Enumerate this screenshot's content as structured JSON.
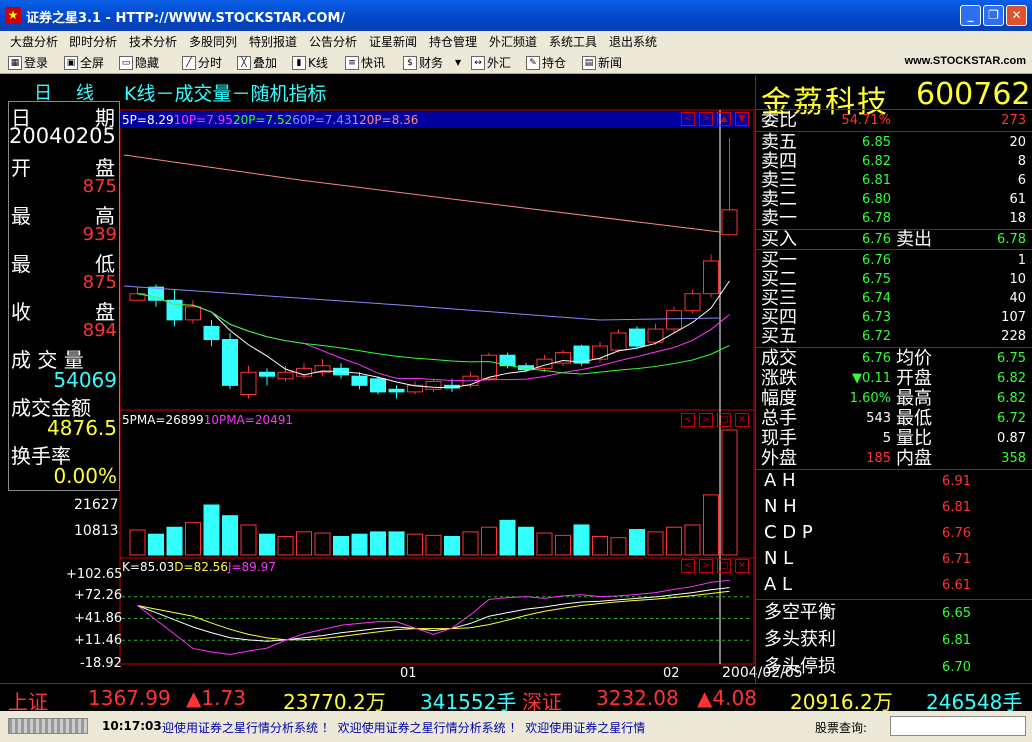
{
  "window": {
    "title": "证券之星3.1 - HTTP://WWW.STOCKSTAR.COM/",
    "min": "_",
    "max": "❐",
    "close": "✕"
  },
  "menu": [
    "大盘分析",
    "即时分析",
    "技术分析",
    "多股同列",
    "特别报道",
    "公告分析",
    "证星新闻",
    "持仓管理",
    "外汇频道",
    "系统工具",
    "退出系统"
  ],
  "toolbar": [
    "登录",
    "全屏",
    "隐藏",
    "分时",
    "叠加",
    "K线",
    "快讯",
    "财务",
    "外汇",
    "持仓",
    "新闻"
  ],
  "toolbar_logo": "www.STOCKSTAR.com",
  "tabs": {
    "day": "日",
    "line": "线"
  },
  "chart_title": "K线－成交量－随机指标",
  "left": {
    "date_label1": "日",
    "date_label2": "期",
    "date": "20040205",
    "open_label1": "开",
    "open_label2": "盘",
    "open": "875",
    "high_label1": "最",
    "high_label2": "高",
    "high": "939",
    "low_label1": "最",
    "low_label2": "低",
    "low": "875",
    "close_label1": "收",
    "close_label2": "盘",
    "close": "894",
    "vol_label": "成 交 量",
    "vol": "54069",
    "amount_label": "成交金额",
    "amount": "4876.5",
    "turnover_label": "换手率",
    "turnover": "0.00%"
  },
  "ma_header": {
    "p1": "5P=",
    "v1": "8.29",
    "p2": "10P=",
    "v2": "7.95",
    "p3": "20P=",
    "v3": "7.52",
    "p4": "60P=",
    "v4": "7.43",
    "p5": "120P=",
    "v5": "8.36"
  },
  "vol_header": {
    "p1": "5PMA=",
    "v1": "26899",
    "p2": "10PMA=",
    "v2": "20491"
  },
  "vol_axis": [
    "21627",
    "10813"
  ],
  "kdj_header": {
    "k_label": "K=",
    "k": "85.03",
    "d_label": "D=",
    "d": "82.56",
    "j_label": "J=",
    "j": "89.97"
  },
  "kdj_axis": [
    "+102.65",
    "+72.26",
    "+41.86",
    "+11.46",
    "-18.92"
  ],
  "x_axis": [
    "01",
    "02"
  ],
  "x_date": "2004/02/05",
  "stock": {
    "name": "金荔科技",
    "code": "600762"
  },
  "orderbook": {
    "weibi_label": "委比",
    "weibi": "54.71%",
    "weicha": "273",
    "sells": [
      {
        "label": "卖五",
        "price": "6.85",
        "vol": "20"
      },
      {
        "label": "卖四",
        "price": "6.82",
        "vol": "8"
      },
      {
        "label": "卖三",
        "price": "6.81",
        "vol": "6"
      },
      {
        "label": "卖二",
        "price": "6.80",
        "vol": "61"
      },
      {
        "label": "卖一",
        "price": "6.78",
        "vol": "18"
      }
    ],
    "buyin_label": "买入",
    "buyin": "6.76",
    "sellout_label": "卖出",
    "sellout": "6.78",
    "buys": [
      {
        "label": "买一",
        "price": "6.76",
        "vol": "1"
      },
      {
        "label": "买二",
        "price": "6.75",
        "vol": "10"
      },
      {
        "label": "买三",
        "price": "6.74",
        "vol": "40"
      },
      {
        "label": "买四",
        "price": "6.73",
        "vol": "107"
      },
      {
        "label": "买五",
        "price": "6.72",
        "vol": "228"
      }
    ]
  },
  "quote": [
    {
      "l1": "成交",
      "v1": "6.76",
      "l2": "均价",
      "v2": "6.75"
    },
    {
      "l1": "涨跌",
      "v1": "▼0.11",
      "l2": "开盘",
      "v2": "6.82"
    },
    {
      "l1": "幅度",
      "v1": "1.60%",
      "l2": "最高",
      "v2": "6.82"
    },
    {
      "l1": "总手",
      "v1": "543",
      "l2": "最低",
      "v2": "6.72"
    },
    {
      "l1": "现手",
      "v1": "5",
      "l2": "量比",
      "v2": "0.87"
    },
    {
      "l1": "外盘",
      "v1": "185",
      "l2": "内盘",
      "v2": "358"
    }
  ],
  "indicators": [
    {
      "label": "A H",
      "value": "6.91"
    },
    {
      "label": "N H",
      "value": "6.81"
    },
    {
      "label": "C D P",
      "value": "6.76"
    },
    {
      "label": "N L",
      "value": "6.71"
    },
    {
      "label": "A L",
      "value": "6.61"
    }
  ],
  "signals": [
    {
      "label": "多空平衡",
      "value": "6.65"
    },
    {
      "label": "多头获利",
      "value": "6.81"
    },
    {
      "label": "多头停损",
      "value": "6.70"
    }
  ],
  "index": {
    "sh_label": "上证",
    "sh": "1367.99",
    "sh_chg": "▲1.73",
    "sh_amt": "23770.2万",
    "sh_vol": "341552手",
    "sz_label": "深证",
    "sz": "3232.08",
    "sz_chg": "▲4.08",
    "sz_amt": "20916.2万",
    "sz_vol": "246548手"
  },
  "status": {
    "time": "10:17:03",
    "ticker": "迎使用证券之星行情分析系统 ！  欢迎使用证券之星行情分析系统 ！  欢迎使用证券之星行情",
    "search_label": "股票查询:"
  },
  "chart_data": {
    "type": "candlestick",
    "candles": [
      {
        "o": 7.7,
        "c": 7.75,
        "h": 7.8,
        "l": 7.7
      },
      {
        "o": 7.8,
        "c": 7.7,
        "h": 7.82,
        "l": 7.65
      },
      {
        "o": 7.7,
        "c": 7.55,
        "h": 7.78,
        "l": 7.5
      },
      {
        "o": 7.55,
        "c": 7.65,
        "h": 7.7,
        "l": 7.52
      },
      {
        "o": 7.5,
        "c": 7.4,
        "h": 7.55,
        "l": 7.35
      },
      {
        "o": 7.4,
        "c": 7.05,
        "h": 7.45,
        "l": 7.02
      },
      {
        "o": 6.98,
        "c": 7.15,
        "h": 7.2,
        "l": 6.95
      },
      {
        "o": 7.15,
        "c": 7.12,
        "h": 7.18,
        "l": 7.05
      },
      {
        "o": 7.1,
        "c": 7.15,
        "h": 7.2,
        "l": 7.08
      },
      {
        "o": 7.12,
        "c": 7.18,
        "h": 7.22,
        "l": 7.1
      },
      {
        "o": 7.15,
        "c": 7.2,
        "h": 7.25,
        "l": 7.12
      },
      {
        "o": 7.18,
        "c": 7.13,
        "h": 7.22,
        "l": 7.1
      },
      {
        "o": 7.12,
        "c": 7.05,
        "h": 7.15,
        "l": 7.02
      },
      {
        "o": 7.1,
        "c": 7.0,
        "h": 7.12,
        "l": 6.98
      },
      {
        "o": 7.02,
        "c": 7.0,
        "h": 7.05,
        "l": 6.95
      },
      {
        "o": 7.0,
        "c": 7.05,
        "h": 7.08,
        "l": 6.98
      },
      {
        "o": 7.02,
        "c": 7.08,
        "h": 7.1,
        "l": 7.0
      },
      {
        "o": 7.05,
        "c": 7.03,
        "h": 7.1,
        "l": 7.0
      },
      {
        "o": 7.05,
        "c": 7.12,
        "h": 7.15,
        "l": 7.03
      },
      {
        "o": 7.1,
        "c": 7.28,
        "h": 7.3,
        "l": 7.08
      },
      {
        "o": 7.28,
        "c": 7.2,
        "h": 7.3,
        "l": 7.18
      },
      {
        "o": 7.2,
        "c": 7.17,
        "h": 7.22,
        "l": 7.15
      },
      {
        "o": 7.18,
        "c": 7.25,
        "h": 7.28,
        "l": 7.15
      },
      {
        "o": 7.22,
        "c": 7.3,
        "h": 7.32,
        "l": 7.2
      },
      {
        "o": 7.35,
        "c": 7.22,
        "h": 7.36,
        "l": 7.2
      },
      {
        "o": 7.25,
        "c": 7.35,
        "h": 7.38,
        "l": 7.22
      },
      {
        "o": 7.32,
        "c": 7.45,
        "h": 7.48,
        "l": 7.3
      },
      {
        "o": 7.48,
        "c": 7.35,
        "h": 7.5,
        "l": 7.33
      },
      {
        "o": 7.38,
        "c": 7.48,
        "h": 7.52,
        "l": 7.36
      },
      {
        "o": 7.48,
        "c": 7.62,
        "h": 7.65,
        "l": 7.45
      },
      {
        "o": 7.62,
        "c": 7.75,
        "h": 7.78,
        "l": 7.6
      },
      {
        "o": 7.75,
        "c": 8.0,
        "h": 8.05,
        "l": 7.72
      },
      {
        "o": 8.2,
        "c": 8.39,
        "h": 8.94,
        "l": 8.2
      }
    ],
    "volume": [
      10813,
      9000,
      12000,
      14000,
      21627,
      17000,
      13000,
      9000,
      8000,
      10000,
      9500,
      8000,
      9000,
      10000,
      10000,
      9000,
      8500,
      8000,
      10000,
      12000,
      15000,
      12000,
      9500,
      8500,
      13000,
      8000,
      7500,
      11000,
      10000,
      12000,
      13000,
      26000,
      54069
    ],
    "kdj_range": [
      -18.92,
      102.65
    ]
  }
}
